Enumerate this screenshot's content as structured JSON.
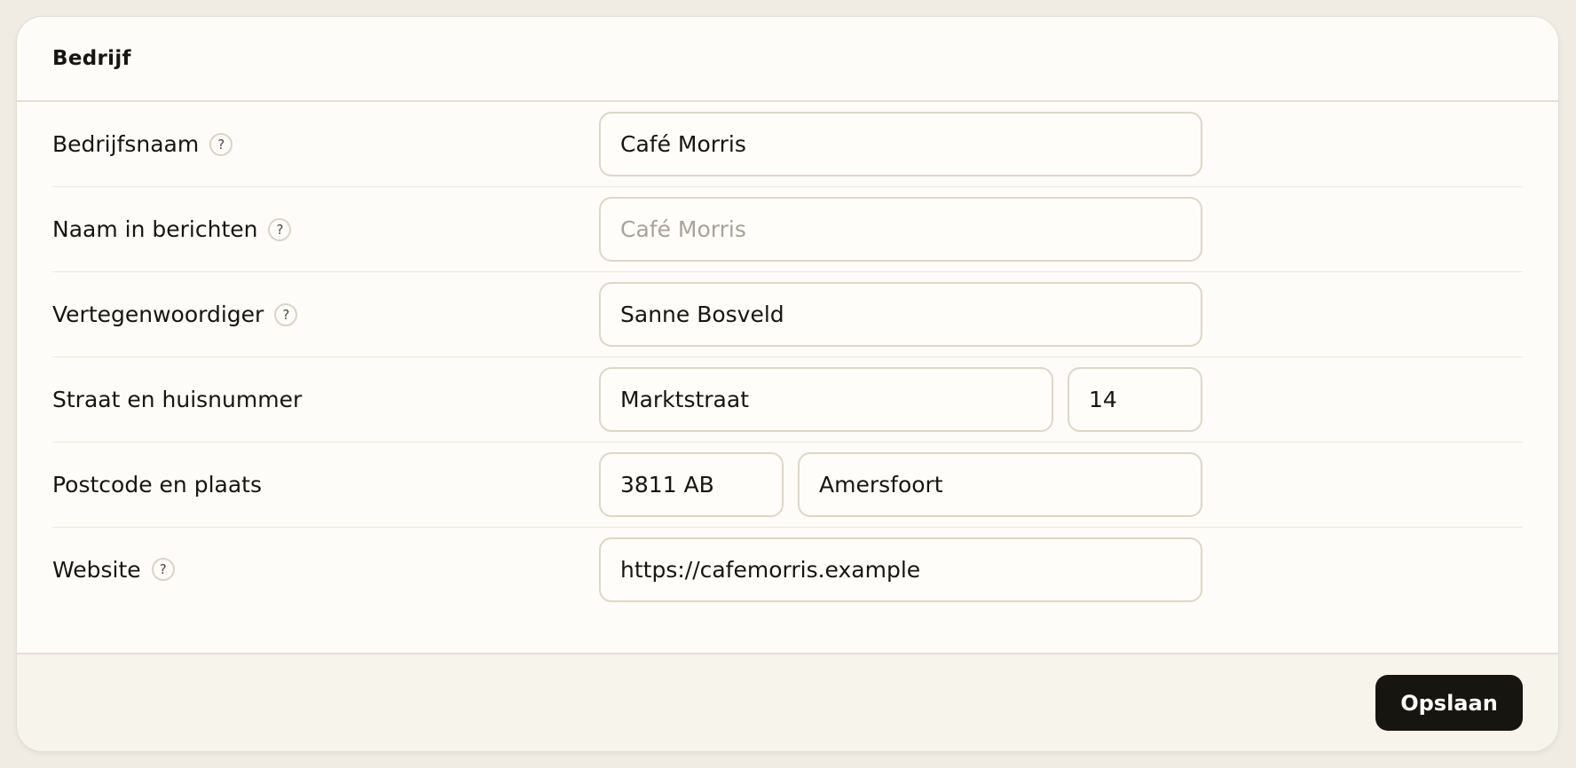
{
  "section": {
    "title": "Bedrijf"
  },
  "fields": {
    "company_name": {
      "label": "Bedrijfsnaam",
      "value": "Café Morris"
    },
    "message_name": {
      "label": "Naam in berichten",
      "value": "",
      "placeholder": "Café Morris"
    },
    "representative": {
      "label": "Vertegenwoordiger",
      "value": "Sanne Bosveld"
    },
    "street": {
      "label": "Straat en huisnummer",
      "street_value": "Marktstraat",
      "number_value": "14"
    },
    "postal": {
      "label": "Postcode en plaats",
      "postcode_value": "3811 AB",
      "city_value": "Amersfoort"
    },
    "website": {
      "label": "Website",
      "value": "https://cafemorris.example"
    }
  },
  "help_icon": {
    "glyph": "?",
    "icon": "help-circle-icon"
  },
  "footer": {
    "save_label": "Opslaan"
  },
  "colors": {
    "page_background": "#f0ece3",
    "card_background": "#fdfcf8",
    "button_background": "#171510",
    "border": "#dcd7c8"
  }
}
